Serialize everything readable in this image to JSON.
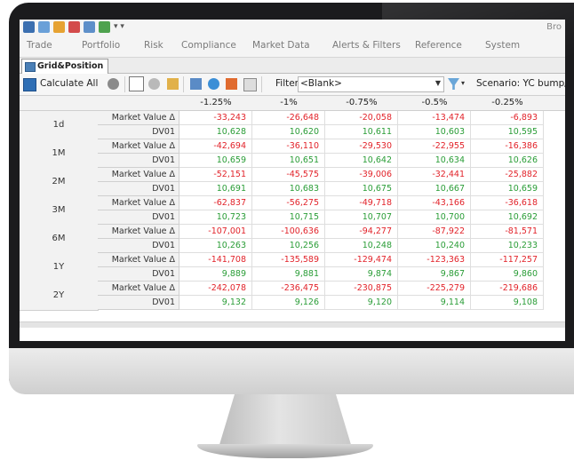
{
  "menu": [
    "Trade",
    "Portfolio",
    "Risk",
    "Compliance",
    "Market Data",
    "Alerts & Filters",
    "Reference",
    "System"
  ],
  "qat_right": "Bro",
  "tab": {
    "label": "Grid&Position"
  },
  "toolbar": {
    "calculate_label": "Calculate All",
    "filter_label": "Filter:",
    "filter_value": "<Blank>",
    "scenario_label": "Scenario: YC bump/Ro"
  },
  "grid": {
    "columns": [
      "-1.25%",
      "-1%",
      "-0.75%",
      "-0.5%",
      "-0.25%"
    ],
    "metric_labels": [
      "Market Value Δ",
      "DV01"
    ],
    "rows": [
      {
        "tenor": "1d",
        "mv": [
          "-33,243",
          "-26,648",
          "-20,058",
          "-13,474",
          "-6,893"
        ],
        "dv01": [
          "10,628",
          "10,620",
          "10,611",
          "10,603",
          "10,595"
        ]
      },
      {
        "tenor": "1M",
        "mv": [
          "-42,694",
          "-36,110",
          "-29,530",
          "-22,955",
          "-16,386"
        ],
        "dv01": [
          "10,659",
          "10,651",
          "10,642",
          "10,634",
          "10,626"
        ]
      },
      {
        "tenor": "2M",
        "mv": [
          "-52,151",
          "-45,575",
          "-39,006",
          "-32,441",
          "-25,882"
        ],
        "dv01": [
          "10,691",
          "10,683",
          "10,675",
          "10,667",
          "10,659"
        ]
      },
      {
        "tenor": "3M",
        "mv": [
          "-62,837",
          "-56,275",
          "-49,718",
          "-43,166",
          "-36,618"
        ],
        "dv01": [
          "10,723",
          "10,715",
          "10,707",
          "10,700",
          "10,692"
        ]
      },
      {
        "tenor": "6M",
        "mv": [
          "-107,001",
          "-100,636",
          "-94,277",
          "-87,922",
          "-81,571"
        ],
        "dv01": [
          "10,263",
          "10,256",
          "10,248",
          "10,240",
          "10,233"
        ]
      },
      {
        "tenor": "1Y",
        "mv": [
          "-141,708",
          "-135,589",
          "-129,474",
          "-123,363",
          "-117,257"
        ],
        "dv01": [
          "9,889",
          "9,881",
          "9,874",
          "9,867",
          "9,860"
        ]
      },
      {
        "tenor": "2Y",
        "mv": [
          "-242,078",
          "-236,475",
          "-230,875",
          "-225,279",
          "-219,686"
        ],
        "dv01": [
          "9,132",
          "9,126",
          "9,120",
          "9,114",
          "9,108"
        ]
      }
    ]
  },
  "colors": {
    "negative": "#e2232a",
    "positive": "#2a9d37"
  },
  "icons": [
    "app-icon",
    "grid-icon",
    "export-icon",
    "settings-icon",
    "table-icon",
    "refresh-icon",
    "calculate-icon",
    "stop-icon",
    "columns-icon",
    "reload-icon",
    "export-grid-icon",
    "move-icon",
    "eye-icon",
    "heatmap-icon",
    "panel-icon",
    "filter-funnel-icon"
  ]
}
